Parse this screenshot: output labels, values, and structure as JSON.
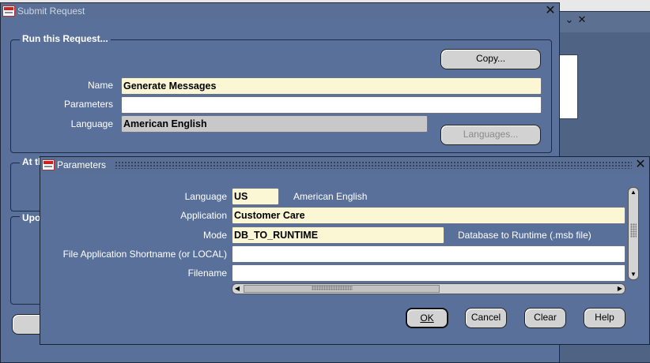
{
  "background_window": {
    "minimize_glyph": "⌄",
    "close_glyph": "✕"
  },
  "submit_request": {
    "title": "Submit Request",
    "close_glyph": "✕",
    "run_group_title": "Run this Request...",
    "copy_button": "Copy...",
    "name_label": "Name",
    "name_value": "Generate Messages",
    "parameters_label": "Parameters",
    "parameters_value": "",
    "language_label": "Language",
    "language_value": "American English",
    "languages_button": "Languages...",
    "at_group_title_partial": "At th",
    "upon_group_title_partial": "Upo"
  },
  "parameters_dialog": {
    "title": "Parameters",
    "close_glyph": "✕",
    "fields": [
      {
        "label": "Language",
        "value": "US",
        "description": "American English"
      },
      {
        "label": "Application",
        "value": "Customer Care",
        "description": ""
      },
      {
        "label": "Mode",
        "value": "DB_TO_RUNTIME",
        "description": "Database to Runtime (.msb file)"
      },
      {
        "label": "File Application Shortname (or LOCAL)",
        "value": "",
        "description": ""
      },
      {
        "label": "Filename",
        "value": "",
        "description": ""
      }
    ],
    "buttons": {
      "ok": "OK",
      "cancel": "Cancel",
      "clear": "Clear",
      "help": "Help"
    }
  }
}
